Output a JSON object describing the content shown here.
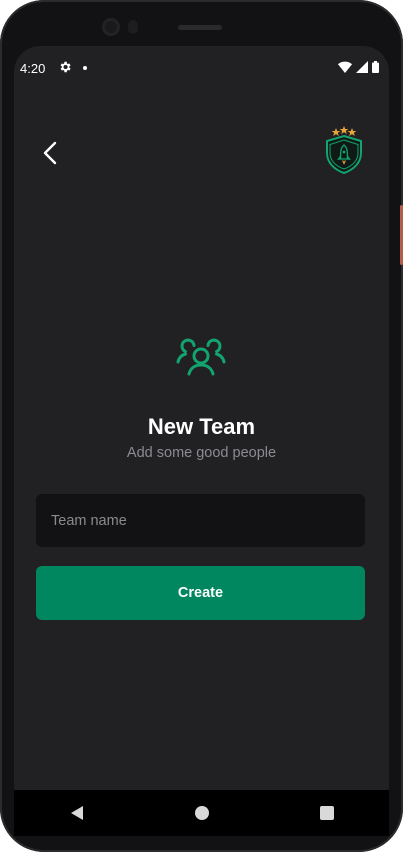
{
  "status_bar": {
    "time": "4:20",
    "icons": [
      "gear-icon",
      "notification-dot",
      "wifi-icon",
      "signal-icon",
      "battery-icon"
    ]
  },
  "header": {
    "back_icon": "chevron-left-icon",
    "logo_icon": "rocket-shield-logo"
  },
  "hero": {
    "icon": "team-users-icon",
    "title": "New Team",
    "subtitle": "Add some good people"
  },
  "form": {
    "team_name": {
      "value": "",
      "placeholder": "Team name"
    },
    "create_label": "Create"
  },
  "nav_bar": {
    "buttons": [
      "back-triangle",
      "home-circle",
      "recents-square"
    ]
  },
  "colors": {
    "background": "#212124",
    "input_background": "#121214",
    "accent": "#00875f",
    "icon_green": "#12a36e",
    "star_gold": "#e8a43a",
    "text_primary": "#ffffff",
    "text_secondary": "#8b8b90"
  }
}
